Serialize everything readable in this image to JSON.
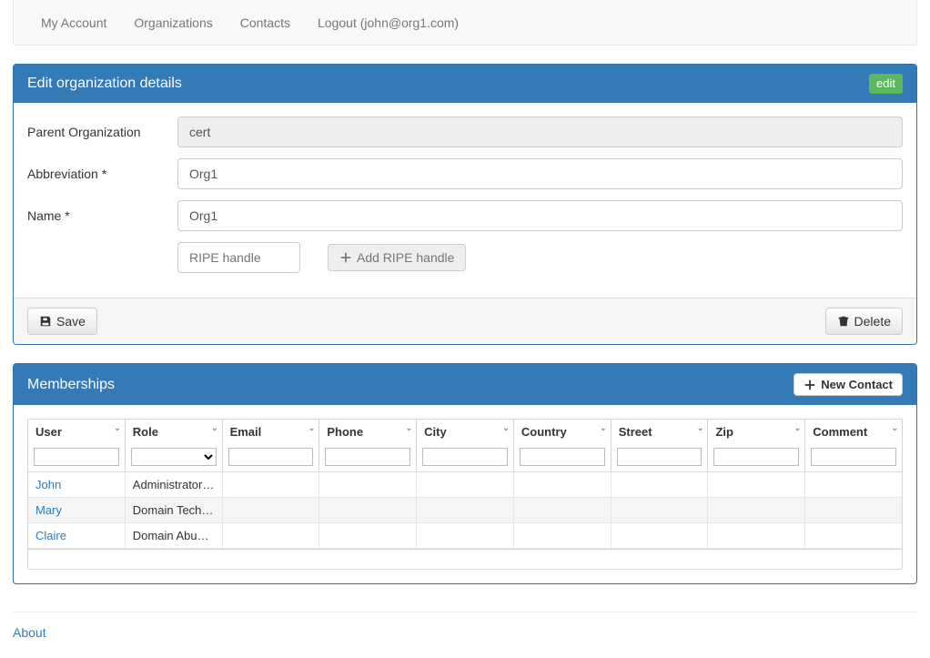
{
  "nav": {
    "my_account": "My Account",
    "organizations": "Organizations",
    "contacts": "Contacts",
    "logout": "Logout (john@org1.com)"
  },
  "edit_panel": {
    "title": "Edit organization details",
    "badge": "edit",
    "parent_org_label": "Parent Organization",
    "parent_org_value": "cert",
    "abbreviation_label": "Abbreviation *",
    "abbreviation_value": "Org1",
    "name_label": "Name *",
    "name_value": "Org1",
    "ripe_placeholder": "RIPE handle",
    "add_ripe_label": "Add RIPE handle",
    "save_label": "Save",
    "delete_label": "Delete"
  },
  "memberships_panel": {
    "title": "Memberships",
    "new_contact_label": "New Contact",
    "columns": {
      "user": "User",
      "role": "Role",
      "email": "Email",
      "phone": "Phone",
      "city": "City",
      "country": "Country",
      "street": "Street",
      "zip": "Zip",
      "comment": "Comment"
    },
    "rows": [
      {
        "user": "John",
        "role": "Administrator O...",
        "email": "",
        "phone": "",
        "city": "",
        "country": "",
        "street": "",
        "zip": "",
        "comment": ""
      },
      {
        "user": "Mary",
        "role": "Domain Techni...",
        "email": "",
        "phone": "",
        "city": "",
        "country": "",
        "street": "",
        "zip": "",
        "comment": ""
      },
      {
        "user": "Claire",
        "role": "Domain Abuse ...",
        "email": "",
        "phone": "",
        "city": "",
        "country": "",
        "street": "",
        "zip": "",
        "comment": ""
      }
    ]
  },
  "footer": {
    "about": "About"
  }
}
